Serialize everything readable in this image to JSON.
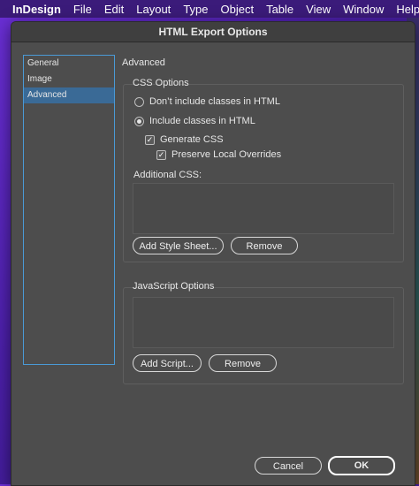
{
  "menubar": {
    "app": "InDesign",
    "items": [
      "File",
      "Edit",
      "Layout",
      "Type",
      "Object",
      "Table",
      "View",
      "Window",
      "Help"
    ]
  },
  "dialog": {
    "title": "HTML Export Options",
    "sidebar": [
      {
        "label": "General",
        "selected": false
      },
      {
        "label": "Image",
        "selected": false
      },
      {
        "label": "Advanced",
        "selected": true
      }
    ],
    "section_title": "Advanced",
    "css_options": {
      "label": "CSS Options",
      "radio_no_classes": "Don’t include classes in HTML",
      "radio_include_classes": "Include classes in HTML",
      "generate_css": "Generate CSS",
      "preserve_overrides": "Preserve Local Overrides",
      "additional_css_label": "Additional CSS:",
      "add_style_sheet": "Add Style Sheet...",
      "remove": "Remove"
    },
    "js_options": {
      "label": "JavaScript Options",
      "add_script": "Add Script...",
      "remove": "Remove"
    },
    "cancel": "Cancel",
    "ok": "OK"
  }
}
